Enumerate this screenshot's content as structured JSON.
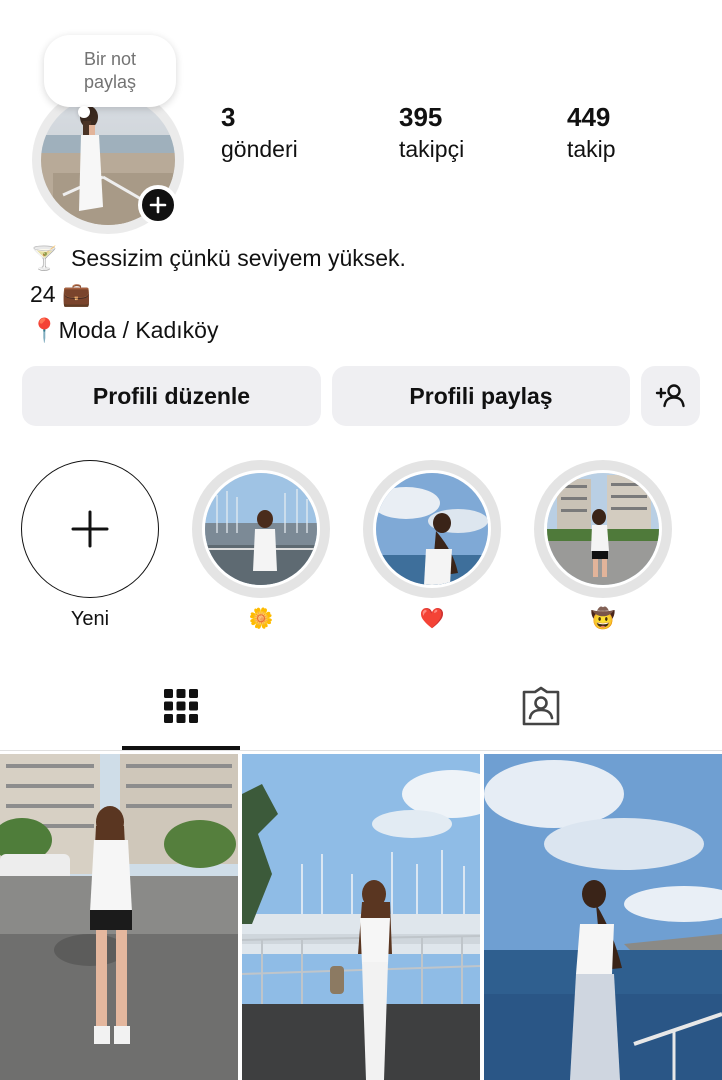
{
  "note": {
    "text": "Bir not\npaylaş"
  },
  "stats": [
    {
      "value": "3",
      "label": "gönderi"
    },
    {
      "value": "395",
      "label": "takipçi"
    },
    {
      "value": "449",
      "label": "takip"
    }
  ],
  "bio": {
    "line1": {
      "emoji": "🍸",
      "text": "Sessizim çünkü seviyem yüksek."
    },
    "line2": {
      "text": "24",
      "emoji": "💼"
    },
    "line3": {
      "emoji": "📍",
      "text": "Moda / Kadıköy"
    }
  },
  "buttons": {
    "edit_profile": "Profili düzenle",
    "share_profile": "Profili paylaş",
    "add_person_icon": "add-person-icon"
  },
  "highlights": [
    {
      "label": "Yeni",
      "kind": "new"
    },
    {
      "label": "🌼",
      "kind": "photo",
      "icon": "daisy"
    },
    {
      "label": "❤️",
      "kind": "photo",
      "icon": "heart"
    },
    {
      "label": "🤠",
      "kind": "photo",
      "icon": "cowboy"
    }
  ],
  "tabs": [
    {
      "name": "grid",
      "icon": "grid-icon",
      "active": true
    },
    {
      "name": "tagged",
      "icon": "tagged-person-icon",
      "active": false
    }
  ],
  "colors": {
    "button_bg": "#efeff2",
    "ring": "#e4e4e4",
    "text": "#111111",
    "muted": "#737373"
  }
}
